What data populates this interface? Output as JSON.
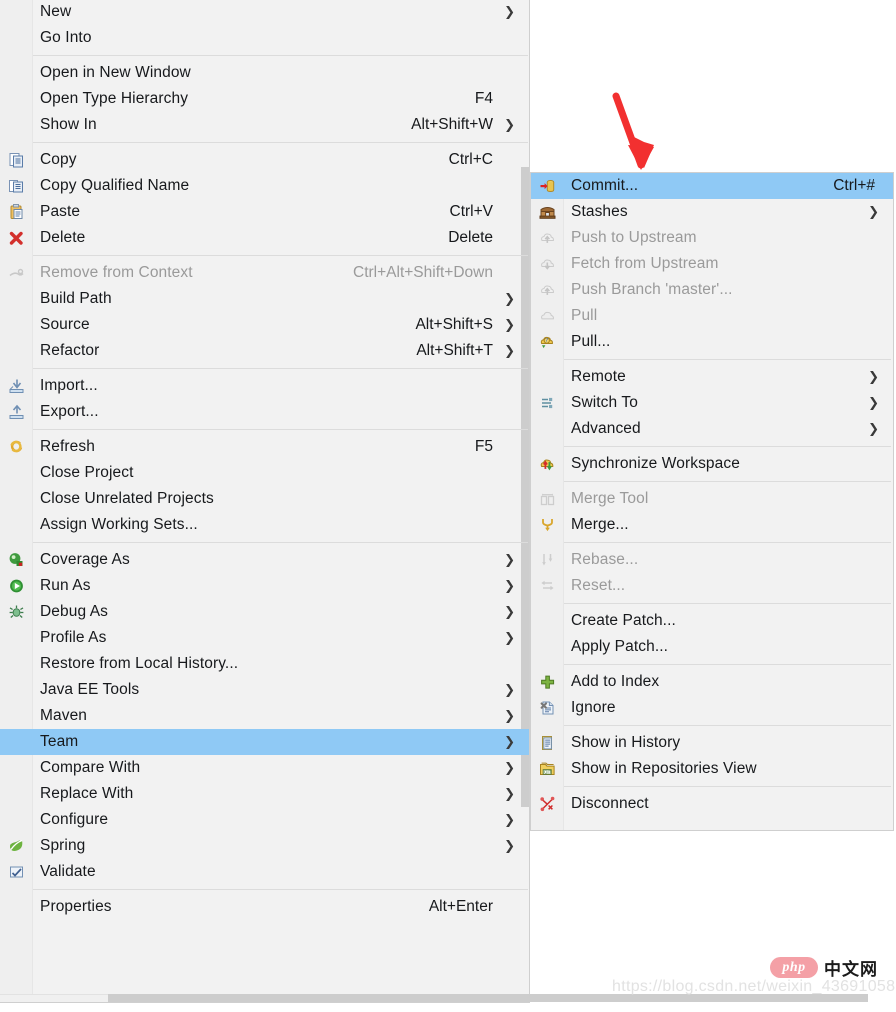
{
  "accent": {
    "selection": "#8fc9f5",
    "menu_bg": "#f2f2f2",
    "gutter_bg": "#efefef",
    "separator": "#dcdcdc",
    "text": "#17191c",
    "disabled_text": "#9a9a9a",
    "arrow_annotation": "#f23030"
  },
  "context_menu": {
    "name": "project-explorer-context-menu",
    "groups": [
      {
        "items": [
          {
            "label": "New",
            "accel": "",
            "submenu": true,
            "icon": "",
            "disabled": false,
            "selected": false
          },
          {
            "label": "Go Into",
            "accel": "",
            "submenu": false,
            "icon": "",
            "disabled": false,
            "selected": false
          }
        ]
      },
      {
        "items": [
          {
            "label": "Open in New Window",
            "accel": "",
            "submenu": false,
            "icon": "",
            "disabled": false,
            "selected": false
          },
          {
            "label": "Open Type Hierarchy",
            "accel": "F4",
            "submenu": false,
            "icon": "",
            "disabled": false,
            "selected": false
          },
          {
            "label": "Show In",
            "accel": "Alt+Shift+W",
            "submenu": true,
            "icon": "",
            "disabled": false,
            "selected": false
          }
        ]
      },
      {
        "items": [
          {
            "label": "Copy",
            "accel": "Ctrl+C",
            "submenu": false,
            "icon": "copy-icon",
            "disabled": false,
            "selected": false
          },
          {
            "label": "Copy Qualified Name",
            "accel": "",
            "submenu": false,
            "icon": "copy-qualified-name-icon",
            "disabled": false,
            "selected": false
          },
          {
            "label": "Paste",
            "accel": "Ctrl+V",
            "submenu": false,
            "icon": "paste-icon",
            "disabled": false,
            "selected": false
          },
          {
            "label": "Delete",
            "accel": "Delete",
            "submenu": false,
            "icon": "delete-x-icon",
            "disabled": false,
            "selected": false
          }
        ]
      },
      {
        "items": [
          {
            "label": "Remove from Context",
            "accel": "Ctrl+Alt+Shift+Down",
            "submenu": false,
            "icon": "remove-from-context-icon",
            "disabled": true,
            "selected": false
          },
          {
            "label": "Build Path",
            "accel": "",
            "submenu": true,
            "icon": "",
            "disabled": false,
            "selected": false
          },
          {
            "label": "Source",
            "accel": "Alt+Shift+S",
            "submenu": true,
            "icon": "",
            "disabled": false,
            "selected": false
          },
          {
            "label": "Refactor",
            "accel": "Alt+Shift+T",
            "submenu": true,
            "icon": "",
            "disabled": false,
            "selected": false
          }
        ]
      },
      {
        "items": [
          {
            "label": "Import...",
            "accel": "",
            "submenu": false,
            "icon": "import-icon",
            "disabled": false,
            "selected": false
          },
          {
            "label": "Export...",
            "accel": "",
            "submenu": false,
            "icon": "export-icon",
            "disabled": false,
            "selected": false
          }
        ]
      },
      {
        "items": [
          {
            "label": "Refresh",
            "accel": "F5",
            "submenu": false,
            "icon": "refresh-icon",
            "disabled": false,
            "selected": false
          },
          {
            "label": "Close Project",
            "accel": "",
            "submenu": false,
            "icon": "",
            "disabled": false,
            "selected": false
          },
          {
            "label": "Close Unrelated Projects",
            "accel": "",
            "submenu": false,
            "icon": "",
            "disabled": false,
            "selected": false
          },
          {
            "label": "Assign Working Sets...",
            "accel": "",
            "submenu": false,
            "icon": "",
            "disabled": false,
            "selected": false
          }
        ]
      },
      {
        "items": [
          {
            "label": "Coverage As",
            "accel": "",
            "submenu": true,
            "icon": "coverage-as-icon",
            "disabled": false,
            "selected": false
          },
          {
            "label": "Run As",
            "accel": "",
            "submenu": true,
            "icon": "run-as-icon",
            "disabled": false,
            "selected": false
          },
          {
            "label": "Debug As",
            "accel": "",
            "submenu": true,
            "icon": "debug-as-bug-icon",
            "disabled": false,
            "selected": false
          },
          {
            "label": "Profile As",
            "accel": "",
            "submenu": true,
            "icon": "",
            "disabled": false,
            "selected": false
          },
          {
            "label": "Restore from Local History...",
            "accel": "",
            "submenu": false,
            "icon": "",
            "disabled": false,
            "selected": false
          },
          {
            "label": "Java EE Tools",
            "accel": "",
            "submenu": true,
            "icon": "",
            "disabled": false,
            "selected": false
          },
          {
            "label": "Maven",
            "accel": "",
            "submenu": true,
            "icon": "",
            "disabled": false,
            "selected": false
          },
          {
            "label": "Team",
            "accel": "",
            "submenu": true,
            "icon": "",
            "disabled": false,
            "selected": true
          },
          {
            "label": "Compare With",
            "accel": "",
            "submenu": true,
            "icon": "",
            "disabled": false,
            "selected": false
          },
          {
            "label": "Replace With",
            "accel": "",
            "submenu": true,
            "icon": "",
            "disabled": false,
            "selected": false
          },
          {
            "label": "Configure",
            "accel": "",
            "submenu": true,
            "icon": "",
            "disabled": false,
            "selected": false
          },
          {
            "label": "Spring",
            "accel": "",
            "submenu": true,
            "icon": "spring-leaf-icon",
            "disabled": false,
            "selected": false
          },
          {
            "label": "Validate",
            "accel": "",
            "submenu": false,
            "icon": "validate-check-icon",
            "disabled": false,
            "selected": false
          }
        ]
      },
      {
        "items": [
          {
            "label": "Properties",
            "accel": "Alt+Enter",
            "submenu": false,
            "icon": "",
            "disabled": false,
            "selected": false
          }
        ]
      }
    ]
  },
  "team_submenu": {
    "name": "team-submenu",
    "groups": [
      {
        "items": [
          {
            "label": "Commit...",
            "accel": "Ctrl+#",
            "submenu": false,
            "icon": "commit-icon",
            "disabled": false,
            "selected": true
          },
          {
            "label": "Stashes",
            "accel": "",
            "submenu": true,
            "icon": "stashes-chest-icon",
            "disabled": false,
            "selected": false
          },
          {
            "label": "Push to Upstream",
            "accel": "",
            "submenu": false,
            "icon": "push-upstream-icon",
            "disabled": true,
            "selected": false
          },
          {
            "label": "Fetch from Upstream",
            "accel": "",
            "submenu": false,
            "icon": "fetch-upstream-icon",
            "disabled": true,
            "selected": false
          },
          {
            "label": "Push Branch 'master'...",
            "accel": "",
            "submenu": false,
            "icon": "push-branch-icon",
            "disabled": true,
            "selected": false
          },
          {
            "label": "Pull",
            "accel": "",
            "submenu": false,
            "icon": "pull-icon",
            "disabled": true,
            "selected": false
          },
          {
            "label": "Pull...",
            "accel": "",
            "submenu": false,
            "icon": "pull-config-icon",
            "disabled": false,
            "selected": false
          }
        ]
      },
      {
        "items": [
          {
            "label": "Remote",
            "accel": "",
            "submenu": true,
            "icon": "",
            "disabled": false,
            "selected": false
          },
          {
            "label": "Switch To",
            "accel": "",
            "submenu": true,
            "icon": "switch-to-branch-icon",
            "disabled": false,
            "selected": false
          },
          {
            "label": "Advanced",
            "accel": "",
            "submenu": true,
            "icon": "",
            "disabled": false,
            "selected": false
          }
        ]
      },
      {
        "items": [
          {
            "label": "Synchronize Workspace",
            "accel": "",
            "submenu": false,
            "icon": "synchronize-icon",
            "disabled": false,
            "selected": false
          }
        ]
      },
      {
        "items": [
          {
            "label": "Merge Tool",
            "accel": "",
            "submenu": false,
            "icon": "merge-tool-icon",
            "disabled": true,
            "selected": false
          },
          {
            "label": "Merge...",
            "accel": "",
            "submenu": false,
            "icon": "merge-icon",
            "disabled": false,
            "selected": false
          }
        ]
      },
      {
        "items": [
          {
            "label": "Rebase...",
            "accel": "",
            "submenu": false,
            "icon": "rebase-icon",
            "disabled": true,
            "selected": false
          },
          {
            "label": "Reset...",
            "accel": "",
            "submenu": false,
            "icon": "reset-icon",
            "disabled": true,
            "selected": false
          }
        ]
      },
      {
        "items": [
          {
            "label": "Create Patch...",
            "accel": "",
            "submenu": false,
            "icon": "",
            "disabled": false,
            "selected": false
          },
          {
            "label": "Apply Patch...",
            "accel": "",
            "submenu": false,
            "icon": "",
            "disabled": false,
            "selected": false
          }
        ]
      },
      {
        "items": [
          {
            "label": "Add to Index",
            "accel": "",
            "submenu": false,
            "icon": "add-to-index-plus-icon",
            "disabled": false,
            "selected": false
          },
          {
            "label": "Ignore",
            "accel": "",
            "submenu": false,
            "icon": "ignore-icon",
            "disabled": false,
            "selected": false
          }
        ]
      },
      {
        "items": [
          {
            "label": "Show in History",
            "accel": "",
            "submenu": false,
            "icon": "show-in-history-icon",
            "disabled": false,
            "selected": false
          },
          {
            "label": "Show in Repositories View",
            "accel": "",
            "submenu": false,
            "icon": "git-repositories-icon",
            "disabled": false,
            "selected": false
          }
        ]
      },
      {
        "items": [
          {
            "label": "Disconnect",
            "accel": "",
            "submenu": false,
            "icon": "disconnect-icon",
            "disabled": false,
            "selected": false
          }
        ]
      }
    ]
  },
  "annotation": {
    "name": "red-arrow-pointing-to-commit",
    "color": "#f23030"
  },
  "watermark": {
    "url": "https://blog.csdn.net/weixin_43691058",
    "logo_text": "php",
    "logo_suffix": "中文网"
  }
}
